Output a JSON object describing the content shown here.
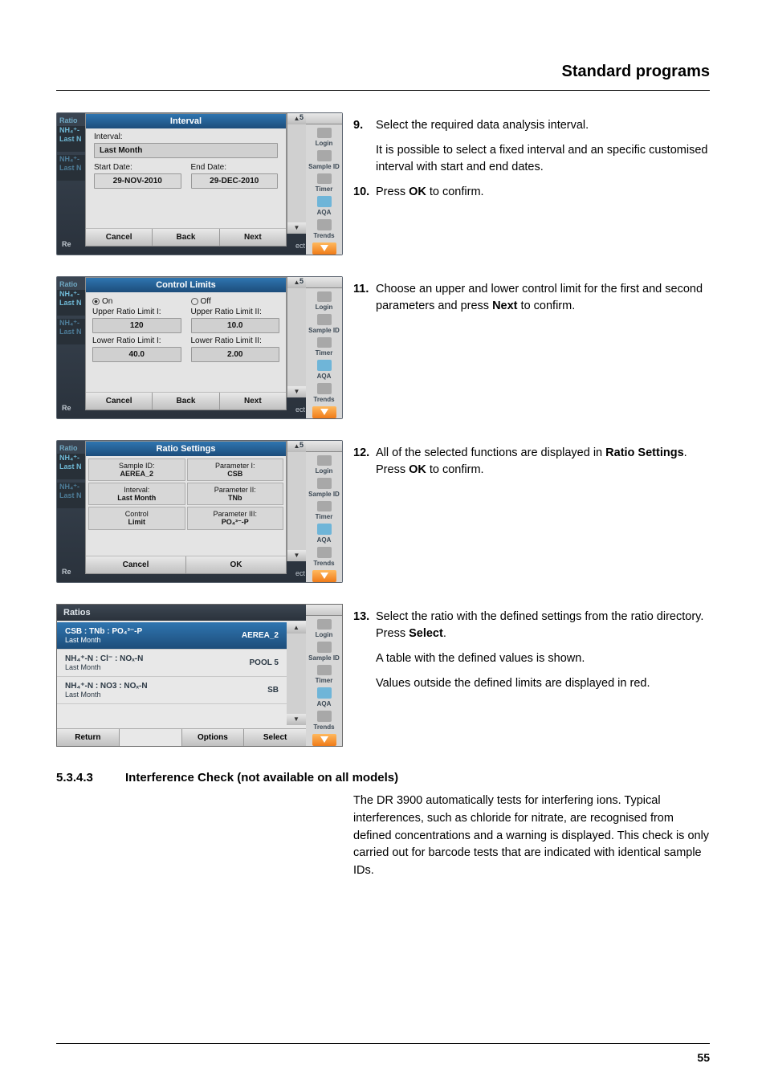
{
  "header": {
    "title": "Standard programs"
  },
  "footer": {
    "page": "55"
  },
  "sidebar": {
    "login": "Login",
    "sample_id": "Sample ID",
    "timer": "Timer",
    "aqa": "AQA",
    "trends": "Trends"
  },
  "panel1": {
    "tab": "Ratio",
    "left_lbl_a": "NH₄⁺-",
    "left_lbl_b": "Last N",
    "title": "Interval",
    "interval_label": "Interval:",
    "interval_value": "Last Month",
    "start_label": "Start Date:",
    "end_label": "End Date:",
    "start_value": "29-NOV-2010",
    "end_value": "29-DEC-2010",
    "cancel": "Cancel",
    "back": "Back",
    "next": "Next",
    "re": "Re",
    "ect": "ect",
    "scroll_num": "_5"
  },
  "panel2": {
    "tab": "Ratio",
    "title": "Control Limits",
    "on": "On",
    "off": "Off",
    "u1l": "Upper Ratio Limit I:",
    "u2l": "Upper Ratio Limit II:",
    "u1v": "120",
    "u2v": "10.0",
    "l1l": "Lower Ratio Limit I:",
    "l2l": "Lower Ratio Limit II:",
    "l1v": "40.0",
    "l2v": "2.00",
    "cancel": "Cancel",
    "back": "Back",
    "next": "Next"
  },
  "panel3": {
    "tab": "Ratio",
    "title": "Ratio Settings",
    "c11a": "Sample ID:",
    "c11b": "AEREA_2",
    "c12a": "Parameter I:",
    "c12b": "CSB",
    "c21a": "Interval:",
    "c21b": "Last Month",
    "c22a": "Parameter II:",
    "c22b": "TNb",
    "c31a": "Control",
    "c31b": "Limit",
    "c32a": "Parameter III:",
    "c32b": "PO₄³⁻-P",
    "cancel": "Cancel",
    "ok": "OK"
  },
  "panel4": {
    "header": "Ratios",
    "row1a": "CSB  :  TNb  :  PO₄³⁻-P",
    "row1b": "Last Month",
    "row1v": "AEREA_2",
    "row2a": "NH₄⁺-N  :  Cl⁻  :  NOₓ-N",
    "row2b": "Last Month",
    "row2v": "POOL 5",
    "row3a": "NH₄⁺-N  :  NO3  :  NOₓ-N",
    "row3b": "Last Month",
    "row3v": "SB",
    "return": "Return",
    "options": "Options",
    "select": "Select"
  },
  "steps": {
    "n9": "9.",
    "t9": "Select the required data analysis interval.",
    "t9b": "It is possible to select a fixed interval and an specific customised interval with start and end dates.",
    "n10": "10.",
    "t10a": "Press ",
    "t10b": "OK",
    "t10c": " to confirm.",
    "n11": "11.",
    "t11a": "Choose an upper and lower control limit for the first and second parameters and press ",
    "t11b": "Next",
    "t11c": " to confirm.",
    "n12": "12.",
    "t12a": "All of the selected functions are displayed in ",
    "t12b": "Ratio Settings",
    "t12c": ". Press ",
    "t12d": "OK",
    "t12e": " to confirm.",
    "n13": "13.",
    "t13a": "Select the ratio with the defined settings from the ratio directory. Press ",
    "t13b": "Select",
    "t13c": ".",
    "t13d": "A table with the defined values is shown.",
    "t13e": "Values outside the defined limits are displayed in red."
  },
  "section": {
    "num": "5.3.4.3",
    "title": "Interference Check (not available on all models)",
    "body": "The DR 3900 automatically tests for interfering ions. Typical interferences, such as chloride for nitrate, are recognised from defined concentrations and a warning is displayed. This check is only carried out for barcode tests that are indicated with identical sample IDs."
  }
}
